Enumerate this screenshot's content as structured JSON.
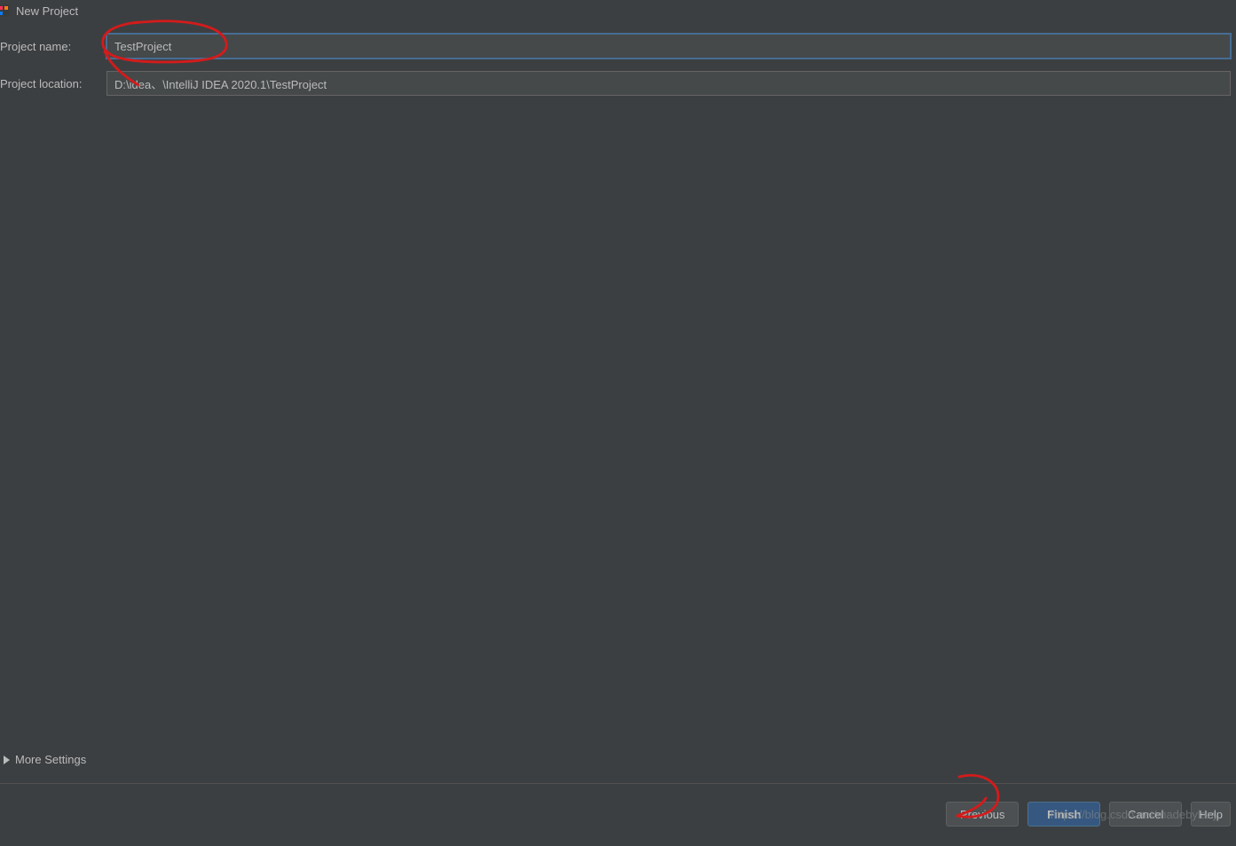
{
  "window": {
    "title": "New Project"
  },
  "form": {
    "name_label": "Project name:",
    "name_value": "TestProject",
    "location_label": "Project location:",
    "location_value": "D:\\idea、\\IntelliJ IDEA 2020.1\\TestProject"
  },
  "expander": {
    "label": "More Settings"
  },
  "buttons": {
    "previous": "Previous",
    "finish": "Finish",
    "cancel": "Cancel",
    "help": "Help"
  },
  "watermark": "https://blog.csdn.net/madebylazy"
}
